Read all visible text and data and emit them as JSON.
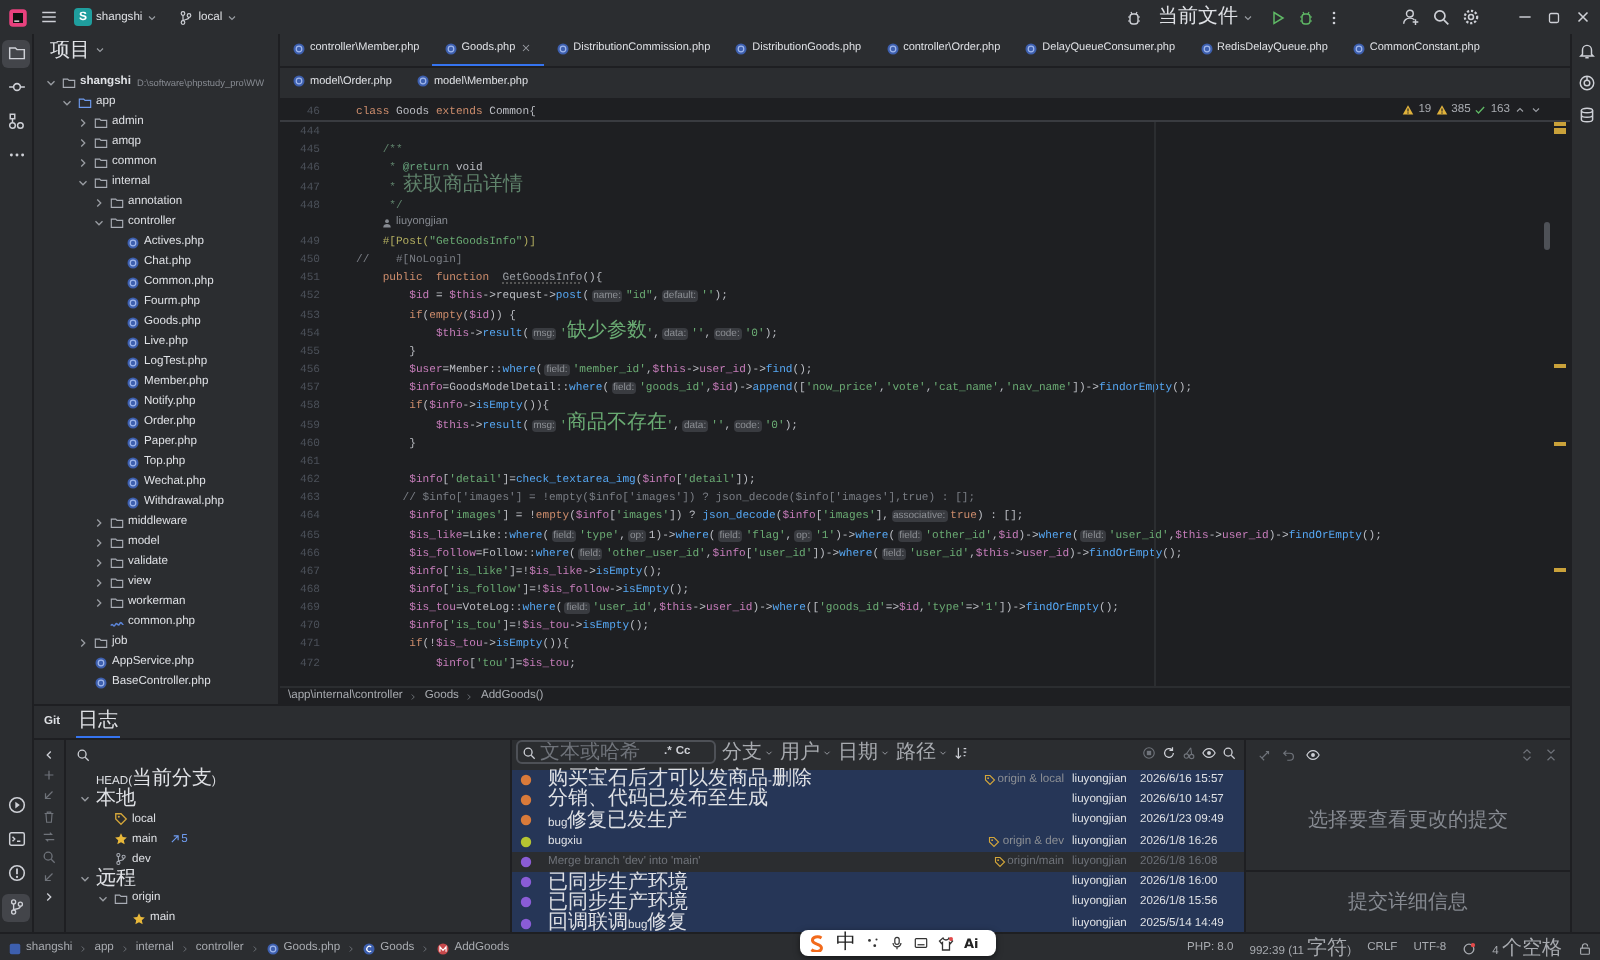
{
  "title_bar": {
    "badge": "S",
    "project": "shangshi",
    "branch": "local",
    "run_config": "当前文件"
  },
  "tool_strip": {
    "top": [
      {
        "kind": "project",
        "selected": true
      },
      {
        "kind": "commit",
        "selected": false
      },
      {
        "kind": "structure",
        "selected": false
      },
      {
        "kind": "more",
        "selected": false
      }
    ],
    "bottom": [
      {
        "kind": "run",
        "selected": false
      },
      {
        "kind": "terminal",
        "selected": false
      },
      {
        "kind": "problems",
        "selected": false
      },
      {
        "kind": "git",
        "selected": true
      }
    ]
  },
  "right_strip": [
    {
      "kind": "notifications"
    },
    {
      "kind": "assistant"
    },
    {
      "kind": "database"
    }
  ],
  "project_panel": {
    "title": "项目",
    "tree": [
      {
        "label": "shangshi",
        "path": "D:\\software\\phpstudy_pro\\WW",
        "kind": "folder",
        "expanded": true,
        "children": [
          {
            "label": "app",
            "kind": "source",
            "expanded": true,
            "children": [
              {
                "label": "admin",
                "kind": "folder",
                "expanded": false
              },
              {
                "label": "amqp",
                "kind": "folder",
                "expanded": false
              },
              {
                "label": "common",
                "kind": "folder",
                "expanded": false
              },
              {
                "label": "internal",
                "kind": "folder",
                "expanded": true,
                "children": [
                  {
                    "label": "annotation",
                    "kind": "folder",
                    "expanded": false
                  },
                  {
                    "label": "controller",
                    "kind": "folder",
                    "expanded": true,
                    "children": [
                      {
                        "label": "Actives.php",
                        "kind": "php"
                      },
                      {
                        "label": "Chat.php",
                        "kind": "php"
                      },
                      {
                        "label": "Common.php",
                        "kind": "php"
                      },
                      {
                        "label": "Fourm.php",
                        "kind": "php"
                      },
                      {
                        "label": "Goods.php",
                        "kind": "php"
                      },
                      {
                        "label": "Live.php",
                        "kind": "php"
                      },
                      {
                        "label": "LogTest.php",
                        "kind": "php"
                      },
                      {
                        "label": "Member.php",
                        "kind": "php"
                      },
                      {
                        "label": "Notify.php",
                        "kind": "php"
                      },
                      {
                        "label": "Order.php",
                        "kind": "php"
                      },
                      {
                        "label": "Paper.php",
                        "kind": "php"
                      },
                      {
                        "label": "Top.php",
                        "kind": "php"
                      },
                      {
                        "label": "Wechat.php",
                        "kind": "php"
                      },
                      {
                        "label": "Withdrawal.php",
                        "kind": "php"
                      }
                    ]
                  },
                  {
                    "label": "middleware",
                    "kind": "folder",
                    "expanded": false
                  },
                  {
                    "label": "model",
                    "kind": "folder",
                    "expanded": false
                  },
                  {
                    "label": "validate",
                    "kind": "folder",
                    "expanded": false
                  },
                  {
                    "label": "view",
                    "kind": "folder",
                    "expanded": false
                  },
                  {
                    "label": "workerman",
                    "kind": "folder",
                    "expanded": false
                  },
                  {
                    "label": "common.php",
                    "kind": "config"
                  }
                ]
              },
              {
                "label": "job",
                "kind": "folder",
                "expanded": false
              },
              {
                "label": "AppService.php",
                "kind": "php"
              },
              {
                "label": "BaseController.php",
                "kind": "php"
              }
            ]
          }
        ]
      }
    ]
  },
  "editor": {
    "tab_rows": [
      [
        {
          "label": "controller\\Member.php",
          "selected": false
        },
        {
          "label": "Goods.php",
          "selected": true
        },
        {
          "label": "DistributionCommission.php",
          "selected": false
        },
        {
          "label": "DistributionGoods.php",
          "selected": false
        },
        {
          "label": "controller\\Order.php",
          "selected": false
        },
        {
          "label": "DelayQueueConsumer.php",
          "selected": false
        },
        {
          "label": "RedisDelayQueue.php",
          "selected": false
        },
        {
          "label": "CommonConstant.php",
          "selected": false
        }
      ],
      [
        {
          "label": "model\\Order.php",
          "selected": false
        },
        {
          "label": "model\\Member.php",
          "selected": false
        }
      ]
    ],
    "inspections": {
      "warnings": "19",
      "weak_warnings": "385",
      "passed": "163"
    },
    "sticky_line": {
      "number": "46",
      "tokens": [
        {
          "kind": "kw",
          "text": "class "
        },
        {
          "kind": "txt",
          "text": "Goods "
        },
        {
          "kind": "kw",
          "text": "extends "
        },
        {
          "kind": "txt",
          "text": "Common{"
        }
      ]
    },
    "lines": [
      {
        "kind": "code",
        "number": "444"
      },
      {
        "kind": "code",
        "number": "445",
        "tokens": [
          {
            "kind": "doc",
            "text": "    /**"
          }
        ]
      },
      {
        "kind": "code",
        "number": "446",
        "tokens": [
          {
            "kind": "doc",
            "text": "     * "
          },
          {
            "kind": "tag",
            "text": "@return"
          },
          {
            "kind": "txt",
            "text": " void"
          }
        ]
      },
      {
        "kind": "code",
        "number": "447",
        "tokens": [
          {
            "kind": "doc",
            "text": "     * 获取商品详情"
          }
        ]
      },
      {
        "kind": "code",
        "number": "448",
        "tokens": [
          {
            "kind": "doc",
            "text": "     */"
          }
        ]
      },
      {
        "kind": "author",
        "text": "liuyongjian"
      },
      {
        "kind": "code",
        "number": "449",
        "tokens": [
          {
            "kind": "attr",
            "text": "    #[Post("
          },
          {
            "kind": "str",
            "text": "\"GetGoodsInfo\""
          },
          {
            "kind": "attr",
            "text": ")]"
          }
        ]
      },
      {
        "kind": "code",
        "number": "450",
        "tokens": [
          {
            "kind": "cmt",
            "text": "//    #[NoLogin]"
          }
        ]
      },
      {
        "kind": "code",
        "number": "451",
        "tokens": [
          {
            "kind": "kw",
            "text": "    public  function  "
          },
          {
            "kind": "dim",
            "text": "GetGoodsInfo"
          },
          {
            "kind": "txt",
            "text": "(){"
          }
        ]
      },
      {
        "kind": "code",
        "number": "452",
        "tokens": [
          {
            "kind": "var",
            "text": "        $id"
          },
          {
            "kind": "txt",
            "text": " = "
          },
          {
            "kind": "var",
            "text": "$this"
          },
          {
            "kind": "txt",
            "text": "->request->"
          },
          {
            "kind": "fn",
            "text": "post"
          },
          {
            "kind": "txt",
            "text": "("
          },
          {
            "kind": "hint",
            "text": "name:"
          },
          {
            "kind": "str",
            "text": "\"id\""
          },
          {
            "kind": "txt",
            "text": ","
          },
          {
            "kind": "hint",
            "text": "default:"
          },
          {
            "kind": "str",
            "text": "''"
          },
          {
            "kind": "txt",
            "text": ");"
          }
        ]
      },
      {
        "kind": "code",
        "number": "453",
        "tokens": [
          {
            "kind": "kw",
            "text": "        if"
          },
          {
            "kind": "txt",
            "text": "("
          },
          {
            "kind": "kw",
            "text": "empty"
          },
          {
            "kind": "txt",
            "text": "("
          },
          {
            "kind": "var",
            "text": "$id"
          },
          {
            "kind": "txt",
            "text": ")) {"
          }
        ]
      },
      {
        "kind": "code",
        "number": "454",
        "tokens": [
          {
            "kind": "var",
            "text": "            $this"
          },
          {
            "kind": "txt",
            "text": "->"
          },
          {
            "kind": "fn",
            "text": "result"
          },
          {
            "kind": "txt",
            "text": "("
          },
          {
            "kind": "hint",
            "text": "msg:"
          },
          {
            "kind": "str",
            "text": "'缺少参数'"
          },
          {
            "kind": "txt",
            "text": ","
          },
          {
            "kind": "hint",
            "text": "data:"
          },
          {
            "kind": "str",
            "text": "''"
          },
          {
            "kind": "txt",
            "text": ","
          },
          {
            "kind": "hint",
            "text": "code:"
          },
          {
            "kind": "str",
            "text": "'0'"
          },
          {
            "kind": "txt",
            "text": ");"
          }
        ]
      },
      {
        "kind": "code",
        "number": "455",
        "tokens": [
          {
            "kind": "txt",
            "text": "        }"
          }
        ]
      },
      {
        "kind": "code",
        "number": "456",
        "tokens": [
          {
            "kind": "var",
            "text": "        $user"
          },
          {
            "kind": "txt",
            "text": "=Member::"
          },
          {
            "kind": "fn",
            "text": "where"
          },
          {
            "kind": "txt",
            "text": "("
          },
          {
            "kind": "hint",
            "text": "field:"
          },
          {
            "kind": "str",
            "text": "'member_id'"
          },
          {
            "kind": "txt",
            "text": ","
          },
          {
            "kind": "var",
            "text": "$this"
          },
          {
            "kind": "txt",
            "text": "->"
          },
          {
            "kind": "var",
            "text": "user_id"
          },
          {
            "kind": "txt",
            "text": ")->"
          },
          {
            "kind": "fn",
            "text": "find"
          },
          {
            "kind": "txt",
            "text": "();"
          }
        ]
      },
      {
        "kind": "code",
        "number": "457",
        "tokens": [
          {
            "kind": "var",
            "text": "        $info"
          },
          {
            "kind": "txt",
            "text": "=GoodsModelDetail::"
          },
          {
            "kind": "fn",
            "text": "where"
          },
          {
            "kind": "txt",
            "text": "("
          },
          {
            "kind": "hint",
            "text": "field:"
          },
          {
            "kind": "str",
            "text": "'goods_id'"
          },
          {
            "kind": "txt",
            "text": ","
          },
          {
            "kind": "var",
            "text": "$id"
          },
          {
            "kind": "txt",
            "text": ")->"
          },
          {
            "kind": "fn",
            "text": "append"
          },
          {
            "kind": "txt",
            "text": "(["
          },
          {
            "kind": "str",
            "text": "'now_price'"
          },
          {
            "kind": "txt",
            "text": ","
          },
          {
            "kind": "str",
            "text": "'vote'"
          },
          {
            "kind": "txt",
            "text": ","
          },
          {
            "kind": "str",
            "text": "'cat_name'"
          },
          {
            "kind": "txt",
            "text": ","
          },
          {
            "kind": "str",
            "text": "'nav_name'"
          },
          {
            "kind": "txt",
            "text": "])->"
          },
          {
            "kind": "fn",
            "text": "findorEmpty"
          },
          {
            "kind": "txt",
            "text": "();"
          }
        ]
      },
      {
        "kind": "code",
        "number": "458",
        "tokens": [
          {
            "kind": "kw",
            "text": "        if"
          },
          {
            "kind": "txt",
            "text": "("
          },
          {
            "kind": "var",
            "text": "$info"
          },
          {
            "kind": "txt",
            "text": "->"
          },
          {
            "kind": "fn",
            "text": "isEmpty"
          },
          {
            "kind": "txt",
            "text": "()){"
          }
        ]
      },
      {
        "kind": "code",
        "number": "459",
        "tokens": [
          {
            "kind": "var",
            "text": "            $this"
          },
          {
            "kind": "txt",
            "text": "->"
          },
          {
            "kind": "fn",
            "text": "result"
          },
          {
            "kind": "txt",
            "text": "("
          },
          {
            "kind": "hint",
            "text": "msg:"
          },
          {
            "kind": "str",
            "text": "'商品不存在'"
          },
          {
            "kind": "txt",
            "text": ","
          },
          {
            "kind": "hint",
            "text": "data:"
          },
          {
            "kind": "str",
            "text": "''"
          },
          {
            "kind": "txt",
            "text": ","
          },
          {
            "kind": "hint",
            "text": "code:"
          },
          {
            "kind": "str",
            "text": "'0'"
          },
          {
            "kind": "txt",
            "text": ");"
          }
        ]
      },
      {
        "kind": "code",
        "number": "460",
        "tokens": [
          {
            "kind": "txt",
            "text": "        }"
          }
        ]
      },
      {
        "kind": "code",
        "number": "461"
      },
      {
        "kind": "code",
        "number": "462",
        "tokens": [
          {
            "kind": "var",
            "text": "        $info"
          },
          {
            "kind": "txt",
            "text": "["
          },
          {
            "kind": "str",
            "text": "'detail'"
          },
          {
            "kind": "txt",
            "text": "]="
          },
          {
            "kind": "fn",
            "text": "check_textarea_img"
          },
          {
            "kind": "txt",
            "text": "("
          },
          {
            "kind": "var",
            "text": "$info"
          },
          {
            "kind": "txt",
            "text": "["
          },
          {
            "kind": "str",
            "text": "'detail'"
          },
          {
            "kind": "txt",
            "text": "]);"
          }
        ]
      },
      {
        "kind": "code",
        "number": "463",
        "tokens": [
          {
            "kind": "cmt",
            "text": "       // $info['images'] = !empty($info['images']) ? json_decode($info['images'],true) : [];"
          }
        ]
      },
      {
        "kind": "code",
        "number": "464",
        "tokens": [
          {
            "kind": "var",
            "text": "        $info"
          },
          {
            "kind": "txt",
            "text": "["
          },
          {
            "kind": "str",
            "text": "'images'"
          },
          {
            "kind": "txt",
            "text": "] = !"
          },
          {
            "kind": "kw",
            "text": "empty"
          },
          {
            "kind": "txt",
            "text": "("
          },
          {
            "kind": "var",
            "text": "$info"
          },
          {
            "kind": "txt",
            "text": "["
          },
          {
            "kind": "str",
            "text": "'images'"
          },
          {
            "kind": "txt",
            "text": "]) ? "
          },
          {
            "kind": "fn",
            "text": "json_decode"
          },
          {
            "kind": "txt",
            "text": "("
          },
          {
            "kind": "var",
            "text": "$info"
          },
          {
            "kind": "txt",
            "text": "["
          },
          {
            "kind": "str",
            "text": "'images'"
          },
          {
            "kind": "txt",
            "text": "],"
          },
          {
            "kind": "hint",
            "text": "associative:"
          },
          {
            "kind": "kw",
            "text": "true"
          },
          {
            "kind": "txt",
            "text": ") : [];"
          }
        ]
      },
      {
        "kind": "code",
        "number": "465",
        "tokens": [
          {
            "kind": "var",
            "text": "        $is_like"
          },
          {
            "kind": "txt",
            "text": "=Like::"
          },
          {
            "kind": "fn",
            "text": "where"
          },
          {
            "kind": "txt",
            "text": "("
          },
          {
            "kind": "hint",
            "text": "field:"
          },
          {
            "kind": "str",
            "text": "'type'"
          },
          {
            "kind": "txt",
            "text": ","
          },
          {
            "kind": "hint",
            "text": "op:"
          },
          {
            "kind": "txt",
            "text": "1)->"
          },
          {
            "kind": "fn",
            "text": "where"
          },
          {
            "kind": "txt",
            "text": "("
          },
          {
            "kind": "hint",
            "text": "field:"
          },
          {
            "kind": "str",
            "text": "'flag'"
          },
          {
            "kind": "txt",
            "text": ","
          },
          {
            "kind": "hint",
            "text": "op:"
          },
          {
            "kind": "str",
            "text": "'1'"
          },
          {
            "kind": "txt",
            "text": ")->"
          },
          {
            "kind": "fn",
            "text": "where"
          },
          {
            "kind": "txt",
            "text": "("
          },
          {
            "kind": "hint",
            "text": "field:"
          },
          {
            "kind": "str",
            "text": "'other_id'"
          },
          {
            "kind": "txt",
            "text": ","
          },
          {
            "kind": "var",
            "text": "$id"
          },
          {
            "kind": "txt",
            "text": ")->"
          },
          {
            "kind": "fn",
            "text": "where"
          },
          {
            "kind": "txt",
            "text": "("
          },
          {
            "kind": "hint",
            "text": "field:"
          },
          {
            "kind": "str",
            "text": "'user_id'"
          },
          {
            "kind": "txt",
            "text": ","
          },
          {
            "kind": "var",
            "text": "$this"
          },
          {
            "kind": "txt",
            "text": "->"
          },
          {
            "kind": "var",
            "text": "user_id"
          },
          {
            "kind": "txt",
            "text": ")->"
          },
          {
            "kind": "fn",
            "text": "findOrEmpty"
          },
          {
            "kind": "txt",
            "text": "();"
          }
        ]
      },
      {
        "kind": "code",
        "number": "466",
        "tokens": [
          {
            "kind": "var",
            "text": "        $is_follow"
          },
          {
            "kind": "txt",
            "text": "=Follow::"
          },
          {
            "kind": "fn",
            "text": "where"
          },
          {
            "kind": "txt",
            "text": "("
          },
          {
            "kind": "hint",
            "text": "field:"
          },
          {
            "kind": "str",
            "text": "'other_user_id'"
          },
          {
            "kind": "txt",
            "text": ","
          },
          {
            "kind": "var",
            "text": "$info"
          },
          {
            "kind": "txt",
            "text": "["
          },
          {
            "kind": "str",
            "text": "'user_id'"
          },
          {
            "kind": "txt",
            "text": "])->"
          },
          {
            "kind": "fn",
            "text": "where"
          },
          {
            "kind": "txt",
            "text": "("
          },
          {
            "kind": "hint",
            "text": "field:"
          },
          {
            "kind": "str",
            "text": "'user_id'"
          },
          {
            "kind": "txt",
            "text": ","
          },
          {
            "kind": "var",
            "text": "$this"
          },
          {
            "kind": "txt",
            "text": "->"
          },
          {
            "kind": "var",
            "text": "user_id"
          },
          {
            "kind": "txt",
            "text": ")->"
          },
          {
            "kind": "fn",
            "text": "findOrEmpty"
          },
          {
            "kind": "txt",
            "text": "();"
          }
        ]
      },
      {
        "kind": "code",
        "number": "467",
        "tokens": [
          {
            "kind": "var",
            "text": "        $info"
          },
          {
            "kind": "txt",
            "text": "["
          },
          {
            "kind": "str",
            "text": "'is_like'"
          },
          {
            "kind": "txt",
            "text": "]=!"
          },
          {
            "kind": "var",
            "text": "$is_like"
          },
          {
            "kind": "txt",
            "text": "->"
          },
          {
            "kind": "fn",
            "text": "isEmpty"
          },
          {
            "kind": "txt",
            "text": "();"
          }
        ]
      },
      {
        "kind": "code",
        "number": "468",
        "tokens": [
          {
            "kind": "var",
            "text": "        $info"
          },
          {
            "kind": "txt",
            "text": "["
          },
          {
            "kind": "str",
            "text": "'is_follow'"
          },
          {
            "kind": "txt",
            "text": "]=!"
          },
          {
            "kind": "var",
            "text": "$is_follow"
          },
          {
            "kind": "txt",
            "text": "->"
          },
          {
            "kind": "fn",
            "text": "isEmpty"
          },
          {
            "kind": "txt",
            "text": "();"
          }
        ]
      },
      {
        "kind": "code",
        "number": "469",
        "tokens": [
          {
            "kind": "var",
            "text": "        $is_tou"
          },
          {
            "kind": "txt",
            "text": "=VoteLog::"
          },
          {
            "kind": "fn",
            "text": "where"
          },
          {
            "kind": "txt",
            "text": "("
          },
          {
            "kind": "hint",
            "text": "field:"
          },
          {
            "kind": "str",
            "text": "'user_id'"
          },
          {
            "kind": "txt",
            "text": ","
          },
          {
            "kind": "var",
            "text": "$this"
          },
          {
            "kind": "txt",
            "text": "->"
          },
          {
            "kind": "var",
            "text": "user_id"
          },
          {
            "kind": "txt",
            "text": ")->"
          },
          {
            "kind": "fn",
            "text": "where"
          },
          {
            "kind": "txt",
            "text": "(["
          },
          {
            "kind": "str",
            "text": "'goods_id'"
          },
          {
            "kind": "txt",
            "text": "=>"
          },
          {
            "kind": "var",
            "text": "$id"
          },
          {
            "kind": "txt",
            "text": ","
          },
          {
            "kind": "str",
            "text": "'type'"
          },
          {
            "kind": "txt",
            "text": "=>"
          },
          {
            "kind": "str",
            "text": "'1'"
          },
          {
            "kind": "txt",
            "text": "])->"
          },
          {
            "kind": "fn",
            "text": "findOrEmpty"
          },
          {
            "kind": "txt",
            "text": "();"
          }
        ]
      },
      {
        "kind": "code",
        "number": "470",
        "tokens": [
          {
            "kind": "var",
            "text": "        $info"
          },
          {
            "kind": "txt",
            "text": "["
          },
          {
            "kind": "str",
            "text": "'is_tou'"
          },
          {
            "kind": "txt",
            "text": "]=!"
          },
          {
            "kind": "var",
            "text": "$is_tou"
          },
          {
            "kind": "txt",
            "text": "->"
          },
          {
            "kind": "fn",
            "text": "isEmpty"
          },
          {
            "kind": "txt",
            "text": "();"
          }
        ]
      },
      {
        "kind": "code",
        "number": "471",
        "tokens": [
          {
            "kind": "kw",
            "text": "        if"
          },
          {
            "kind": "txt",
            "text": "(!"
          },
          {
            "kind": "var",
            "text": "$is_tou"
          },
          {
            "kind": "txt",
            "text": "->"
          },
          {
            "kind": "fn",
            "text": "isEmpty"
          },
          {
            "kind": "txt",
            "text": "()){"
          }
        ]
      },
      {
        "kind": "code",
        "number": "472",
        "tokens": [
          {
            "kind": "var",
            "text": "            $info"
          },
          {
            "kind": "txt",
            "text": "["
          },
          {
            "kind": "str",
            "text": "'tou'"
          },
          {
            "kind": "txt",
            "text": "]="
          },
          {
            "kind": "var",
            "text": "$is_tou"
          },
          {
            "kind": "txt",
            "text": ";"
          }
        ]
      }
    ],
    "breadcrumb": [
      "\\app\\internal\\controller",
      "Goods",
      "AddGoods()"
    ]
  },
  "git": {
    "title": "Git",
    "tabs": [
      {
        "label": "日志",
        "selected": true
      }
    ],
    "branches": [
      {
        "label": "HEAD(当前分支)"
      },
      {
        "label": "本地",
        "expanded": true,
        "children": [
          {
            "label": "local",
            "kind": "tag"
          },
          {
            "label": "main",
            "kind": "star",
            "ahead": "5"
          },
          {
            "label": "dev",
            "kind": "branch"
          }
        ]
      },
      {
        "label": "远程",
        "expanded": true,
        "children": [
          {
            "label": "origin",
            "kind": "folder",
            "expanded": true,
            "children": [
              {
                "label": "main",
                "kind": "star"
              }
            ]
          }
        ]
      }
    ],
    "log": {
      "placeholder": "文本或哈希",
      "regex": ".*",
      "match_case": "Cc",
      "filters": [
        "分支",
        "用户",
        "日期",
        "路径"
      ],
      "commits": [
        {
          "kind": "commit",
          "message": "购买宝石后才可以发商品-删除",
          "refs": "origin & local",
          "author": "liuyongjian",
          "date": "2026/6/16 15:57",
          "color": "#d97a3a",
          "selected": true
        },
        {
          "kind": "commit",
          "message": "分销、代码已发布至生成",
          "author": "liuyongjian",
          "date": "2026/6/10 14:57",
          "color": "#d97a3a",
          "selected": true
        },
        {
          "kind": "commit",
          "message": "bug修复已发生产",
          "author": "liuyongjian",
          "date": "2026/1/23 09:49",
          "color": "#d97a3a",
          "selected": true
        },
        {
          "kind": "commit",
          "message": "bugxiu",
          "refs": "origin & dev",
          "author": "liuyongjian",
          "date": "2026/1/8 16:26",
          "color": "#b5c431",
          "selected": true
        },
        {
          "kind": "merge",
          "message": "Merge branch 'dev' into 'main'",
          "refs": "origin/main",
          "author": "liuyongjian",
          "date": "2026/1/8 16:08",
          "color": "#8a5cd6",
          "selected": false
        },
        {
          "kind": "commit",
          "message": "已同步生产环境",
          "author": "liuyongjian",
          "date": "2026/1/8 16:00",
          "color": "#8a5cd6",
          "selected": true
        },
        {
          "kind": "commit",
          "message": "已同步生产环境",
          "author": "liuyongjian",
          "date": "2026/1/8 15:56",
          "color": "#8a5cd6",
          "selected": true
        },
        {
          "kind": "commit",
          "message": "回调联调bug修复",
          "author": "liuyongjian",
          "date": "2025/5/14 14:49",
          "color": "#8a5cd6",
          "selected": true
        }
      ]
    },
    "details": {
      "changes_hint": "选择要查看更改的提交",
      "details_hint": "提交详细信息"
    }
  },
  "status_bar": {
    "path": [
      {
        "label": "shangshi",
        "kind": "project"
      },
      {
        "label": "app",
        "kind": "folder"
      },
      {
        "label": "internal",
        "kind": "folder"
      },
      {
        "label": "controller",
        "kind": "folder"
      },
      {
        "label": "Goods.php",
        "kind": "php"
      },
      {
        "label": "Goods",
        "kind": "class"
      },
      {
        "label": "AddGoods",
        "kind": "method"
      }
    ],
    "php": "PHP: 8.0",
    "position": "992:39 (11 字符)",
    "line_separator": "CRLF",
    "encoding": "UTF-8",
    "indent": "4 个空格"
  },
  "input_method": {
    "mode": "中",
    "ai": "Ai"
  }
}
